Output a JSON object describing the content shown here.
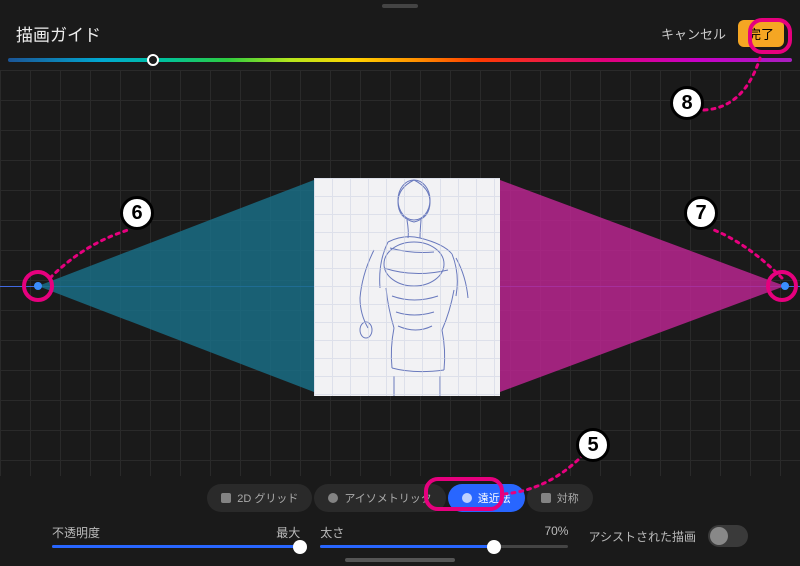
{
  "header": {
    "title": "描画ガイド",
    "cancel": "キャンセル",
    "done": "完了"
  },
  "modes": {
    "grid2d": "2D グリッド",
    "isometric": "アイソメトリック",
    "perspective": "遠近法",
    "symmetry": "対称"
  },
  "sliders": {
    "opacity_label": "不透明度",
    "opacity_value": "最大",
    "thickness_label": "太さ",
    "thickness_value": "70%",
    "assisted_label": "アシストされた描画"
  },
  "annotations": {
    "n5": "5",
    "n6": "6",
    "n7": "7",
    "n8": "8"
  }
}
